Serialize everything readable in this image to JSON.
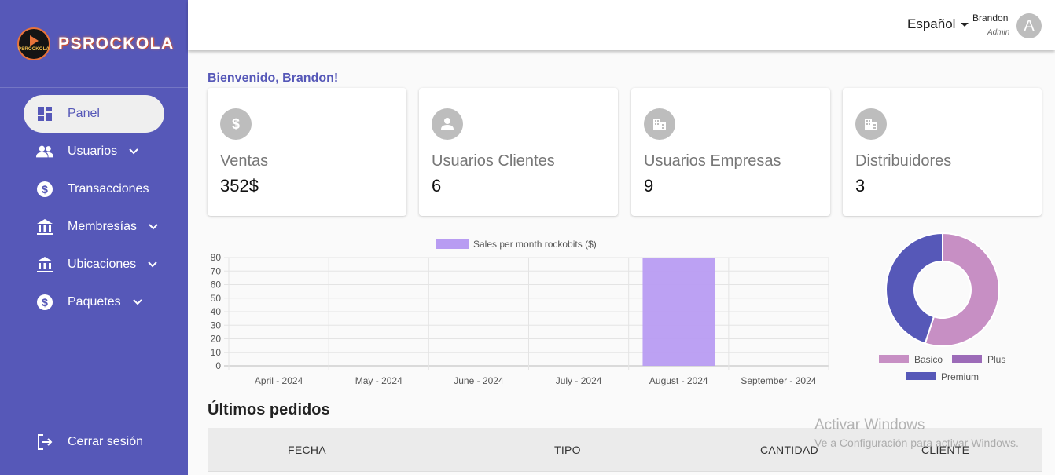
{
  "brand": {
    "name": "PSROCKOLA",
    "logo_text": "PSROCKOLA"
  },
  "sidebar": {
    "items": [
      {
        "label": "Panel",
        "icon": "dashboard-icon"
      },
      {
        "label": "Usuarios",
        "icon": "people-icon"
      },
      {
        "label": "Transacciones",
        "icon": "dollar-icon"
      },
      {
        "label": "Membresías",
        "icon": "bank-icon"
      },
      {
        "label": "Ubicaciones",
        "icon": "bank-icon"
      },
      {
        "label": "Paquetes",
        "icon": "dollar-icon"
      }
    ],
    "logout": "Cerrar sesión"
  },
  "header": {
    "language": "Español",
    "user_name": "Brandon",
    "user_role": "Admin",
    "avatar_letter": "A"
  },
  "welcome": "Bienvenido, Brandon!",
  "cards": [
    {
      "title": "Ventas",
      "value": "352$",
      "icon": "dollar-icon"
    },
    {
      "title": "Usuarios Clientes",
      "value": "6",
      "icon": "person-icon"
    },
    {
      "title": "Usuarios Empresas",
      "value": "9",
      "icon": "building-icon"
    },
    {
      "title": "Distribuidores",
      "value": "3",
      "icon": "building-icon"
    }
  ],
  "chart_data": [
    {
      "type": "bar",
      "legend": "Sales per month rockobits ($)",
      "categories": [
        "April - 2024",
        "May - 2024",
        "June - 2024",
        "July - 2024",
        "August - 2024",
        "September - 2024"
      ],
      "values": [
        0,
        0,
        0,
        0,
        80,
        0
      ],
      "ylim": [
        0,
        80
      ],
      "yticks": [
        0,
        10,
        20,
        30,
        40,
        50,
        60,
        70,
        80
      ],
      "grid": true,
      "legend_position": "top",
      "color": "#b89cf2"
    },
    {
      "type": "pie",
      "variant": "donut",
      "labels": [
        "Basico",
        "Plus",
        "Premium"
      ],
      "values": [
        55,
        0,
        45
      ],
      "colors": [
        "#c78fc4",
        "#9c6bb8",
        "#5658b8"
      ],
      "legend_position": "bottom"
    }
  ],
  "orders": {
    "title": "Últimos pedidos",
    "columns": [
      "FECHA",
      "TIPO",
      "CANTIDAD",
      "CLIENTE"
    ]
  },
  "watermark": {
    "line1": "Activar Windows",
    "line2": "Ve a Configuración para activar Windows."
  }
}
